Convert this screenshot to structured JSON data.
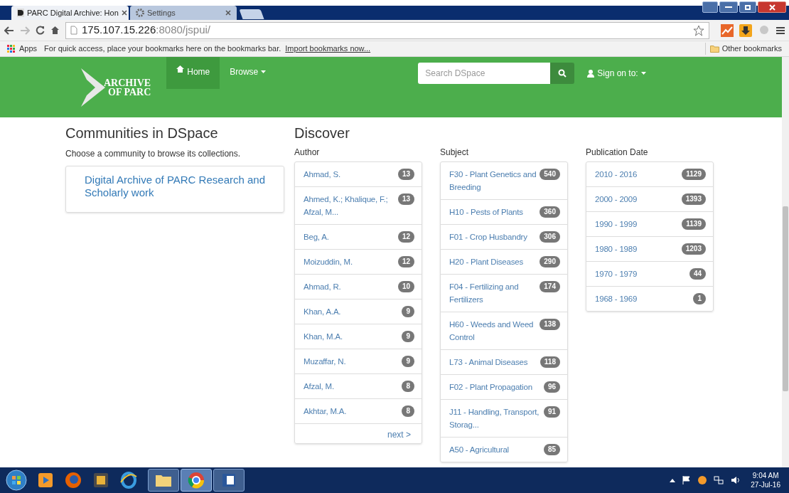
{
  "browser": {
    "tabs": [
      {
        "title": "PARC Digital Archive: Hon",
        "selected": true,
        "kind": "site"
      },
      {
        "title": "Settings",
        "selected": false,
        "kind": "settings"
      }
    ],
    "url_host": "175.107.15.226",
    "url_path": ":8080/jspui/",
    "bookmarks_bar": {
      "apps": "Apps",
      "hint": "For quick access, place your bookmarks here on the bookmarks bar.",
      "import_link": "Import bookmarks now...",
      "other": "Other bookmarks"
    }
  },
  "navbar": {
    "logo_line_1": "ARCHIVE",
    "logo_line_2": "OF PARC",
    "items": [
      {
        "label": "Home",
        "selected": true,
        "kind": "home"
      },
      {
        "label": "Browse",
        "selected": false,
        "kind": "dropdown"
      }
    ],
    "search_placeholder": "Search DSpace",
    "sign_on": "Sign on to:"
  },
  "communities": {
    "heading": "Communities in DSpace",
    "hint": "Choose a community to browse its collections.",
    "items": [
      "Digital Archive of PARC Research and Scholarly work"
    ]
  },
  "discover": {
    "heading": "Discover",
    "facets": [
      {
        "title": "Author",
        "next": "next >",
        "items": [
          {
            "label": "Ahmad, S.",
            "count": "13"
          },
          {
            "label": "Ahmed, K.; Khalique, F.; Afzal, M...",
            "count": "13"
          },
          {
            "label": "Beg, A.",
            "count": "12"
          },
          {
            "label": "Moizuddin, M.",
            "count": "12"
          },
          {
            "label": "Ahmad, R.",
            "count": "10"
          },
          {
            "label": "Khan, A.A.",
            "count": "9"
          },
          {
            "label": "Khan, M.A.",
            "count": "9"
          },
          {
            "label": "Muzaffar, N.",
            "count": "9"
          },
          {
            "label": "Afzal, M.",
            "count": "8"
          },
          {
            "label": "Akhtar, M.A.",
            "count": "8"
          }
        ]
      },
      {
        "title": "Subject",
        "items": [
          {
            "label": "F30 - Plant Genetics and Breeding",
            "count": "540"
          },
          {
            "label": "H10 - Pests of Plants",
            "count": "360"
          },
          {
            "label": "F01 - Crop Husbandry",
            "count": "306"
          },
          {
            "label": "H20 - Plant Diseases",
            "count": "290"
          },
          {
            "label": "F04 - Fertilizing and Fertilizers",
            "count": "174"
          },
          {
            "label": "H60 - Weeds and Weed Control",
            "count": "138"
          },
          {
            "label": "L73 - Animal Diseases",
            "count": "118"
          },
          {
            "label": "F02 - Plant Propagation",
            "count": "96"
          },
          {
            "label": "J11 - Handling, Transport, Storag...",
            "count": "91"
          },
          {
            "label": "A50 - Agricultural",
            "count": "85"
          }
        ]
      },
      {
        "title": "Publication Date",
        "items": [
          {
            "label": "2010 - 2016",
            "count": "1129"
          },
          {
            "label": "2000 - 2009",
            "count": "1393"
          },
          {
            "label": "1990 - 1999",
            "count": "1139"
          },
          {
            "label": "1980 - 1989",
            "count": "1203"
          },
          {
            "label": "1970 - 1979",
            "count": "44"
          },
          {
            "label": "1968 - 1969",
            "count": "1"
          }
        ]
      }
    ]
  },
  "taskbar": {
    "time": "9:04 AM",
    "date": "27-Jul-16"
  }
}
